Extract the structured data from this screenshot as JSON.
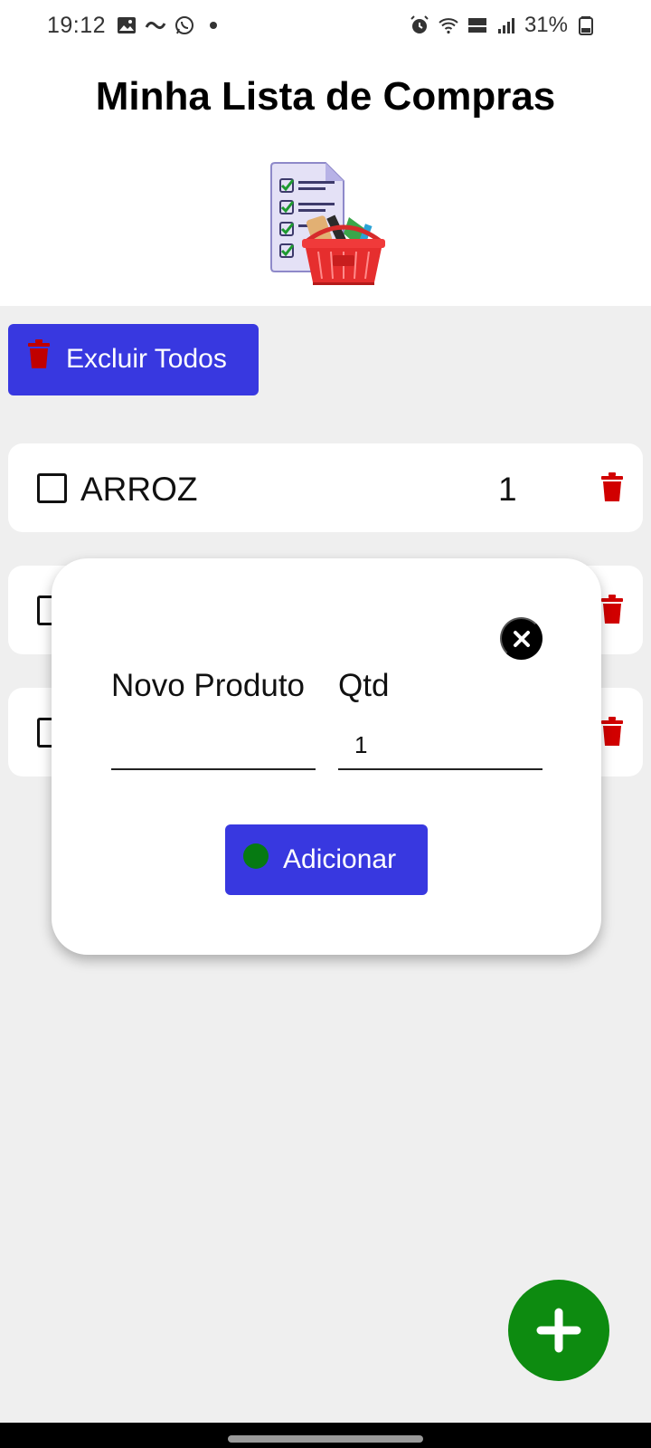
{
  "status_bar": {
    "time": "19:12",
    "battery": "31%",
    "left_icons": [
      "gallery-icon",
      "ifood-icon",
      "whatsapp-icon",
      "dot-icon"
    ],
    "right_icons": [
      "alarm-icon",
      "wifi-icon",
      "volte-icon",
      "signal-icon",
      "battery-icon"
    ]
  },
  "header": {
    "title": "Minha Lista de Compras",
    "logo_icon": "shopping-list-basket-icon"
  },
  "toolbar": {
    "delete_all_label": "Excluir Todos"
  },
  "list": {
    "items": [
      {
        "name": "ARROZ",
        "qty": "1"
      }
    ]
  },
  "modal": {
    "product_label": "Novo Produto",
    "qty_label": "Qtd",
    "product_value": "",
    "qty_value": "1",
    "add_label": "Adicionar"
  },
  "colors": {
    "primary_button": "#3838e0",
    "fab": "#0d8b10",
    "trash": "#d10000",
    "add_dot": "#067a12"
  }
}
